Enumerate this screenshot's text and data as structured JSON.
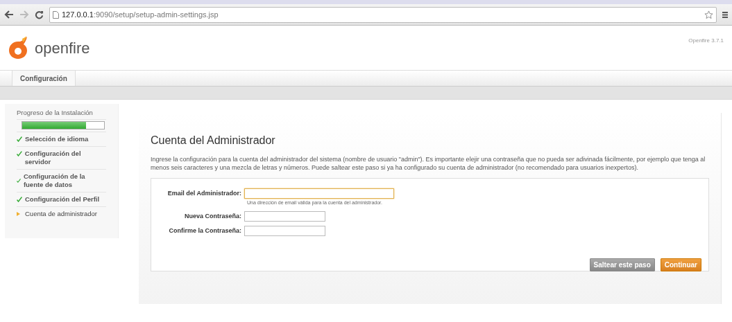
{
  "browser": {
    "url_host": "127.0.0.1",
    "url_path": ":9090/setup/setup-admin-settings.jsp"
  },
  "header": {
    "logo_text": "openfire",
    "version": "Openfire 3.7.1"
  },
  "tabs": [
    {
      "label": "Configuración"
    }
  ],
  "sidebar": {
    "title": "Progreso de la Instalación",
    "level": 0.78,
    "items": [
      {
        "label": "Selección de idioma",
        "done": true
      },
      {
        "label": "Configuración del servidor",
        "done": true
      },
      {
        "label": "Configuración de la fuente de datos",
        "done": true
      },
      {
        "label": "Configuración del Perfil",
        "done": true
      },
      {
        "label": "Cuenta de administrador",
        "done": false
      }
    ]
  },
  "main": {
    "title": "Cuenta del Administrador",
    "description": "Ingrese la configuración para la cuenta del administrador del sistema (nombre de usuario \"admin\"). Es importante elejir una contraseña que no pueda ser adivinada fácilmente, por ejemplo que tenga al menos seis caracteres y una mezcla de letras y números. Puede saltear este paso si ya ha configurado su cuenta de administrador (no recomendado para usuarios inexpertos).",
    "fields": [
      {
        "label": "Email del Administrador:",
        "hint": "Una dirección de email válida para la cuenta del administrador.",
        "focused": true
      },
      {
        "label": "Nueva Contraseña:",
        "focused": false
      },
      {
        "label": "Confirme la Contraseña:",
        "focused": false
      }
    ],
    "buttons": [
      {
        "label": "Saltear este paso",
        "kind": "secondary"
      },
      {
        "label": "Continuar",
        "kind": "primary"
      }
    ]
  }
}
